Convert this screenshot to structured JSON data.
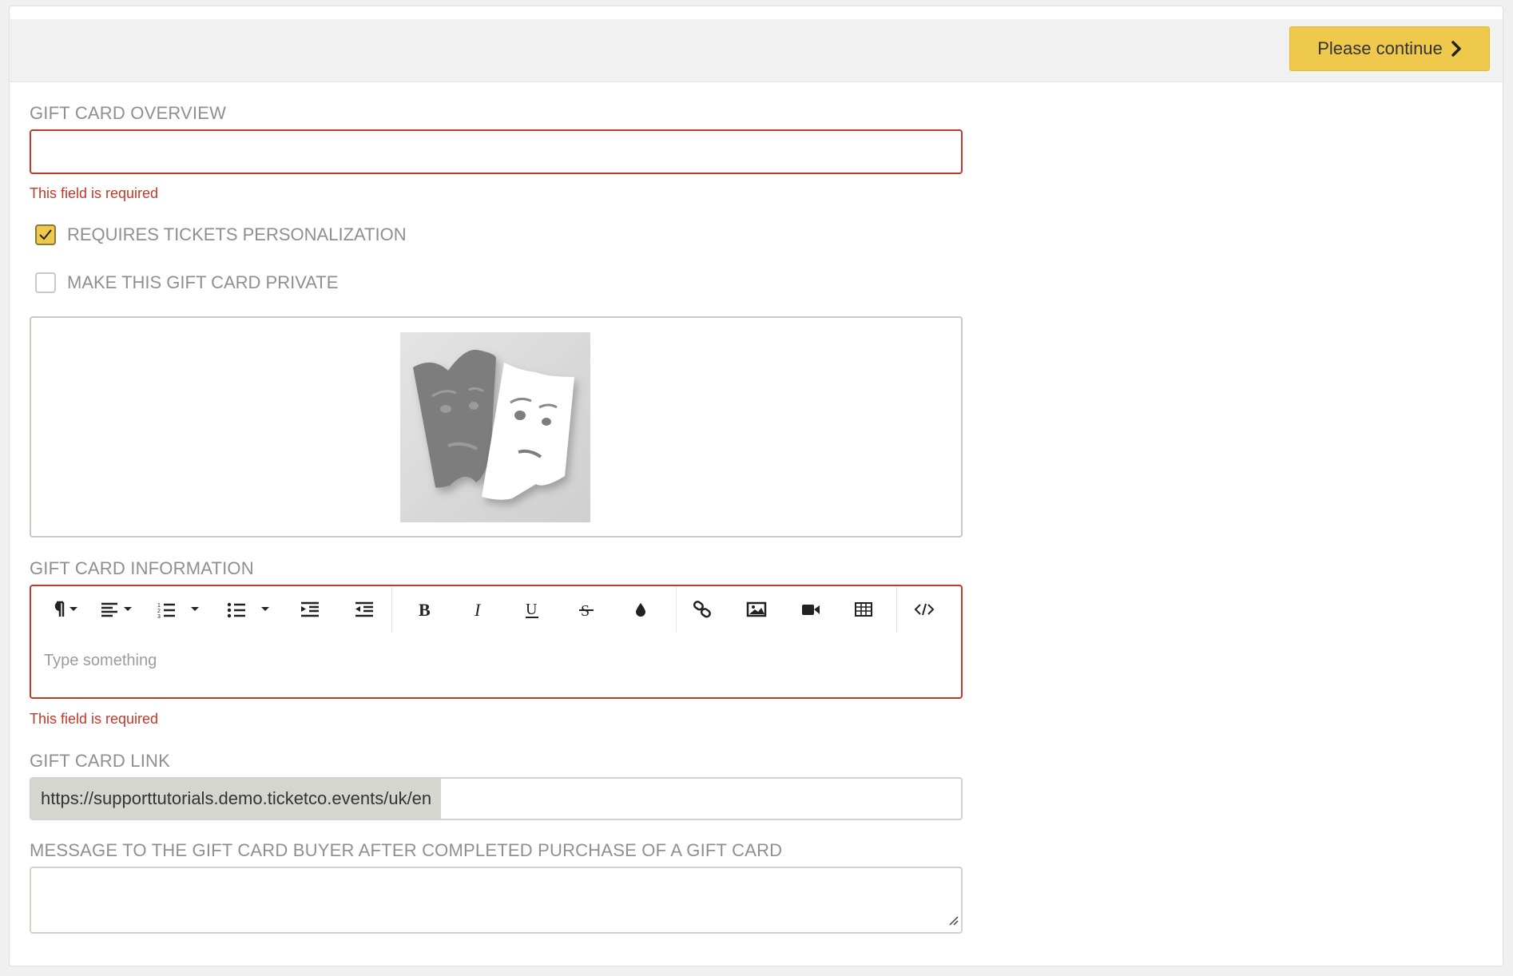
{
  "header": {
    "continue_label": "Please continue",
    "continue_icon": "chevron-right-icon"
  },
  "overview": {
    "label": "GIFT CARD OVERVIEW",
    "value": "",
    "error": "This field is required"
  },
  "options": [
    {
      "label": "REQUIRES TICKETS PERSONALIZATION",
      "checked": true
    },
    {
      "label": "MAKE THIS GIFT CARD PRIVATE",
      "checked": false
    }
  ],
  "image": {
    "icon": "theater-masks-tickets-logo"
  },
  "information": {
    "label": "GIFT CARD INFORMATION",
    "placeholder": "Type something",
    "error": "This field is required",
    "toolbar": [
      "paragraph-format-icon",
      "align-icon",
      "ordered-list-icon",
      "unordered-list-icon",
      "indent-icon",
      "outdent-icon",
      "bold-icon",
      "italic-icon",
      "underline-icon",
      "strikethrough-icon",
      "text-color-icon",
      "link-icon",
      "image-icon",
      "video-icon",
      "table-icon",
      "code-view-icon"
    ]
  },
  "link": {
    "label": "GIFT CARD LINK",
    "prefix": "https://supporttutorials.demo.ticketco.events/uk/en",
    "value": ""
  },
  "message": {
    "label": "MESSAGE TO THE GIFT CARD BUYER AFTER COMPLETED PURCHASE OF A GIFT CARD",
    "value": ""
  },
  "colors": {
    "accent": "#efc94c",
    "error": "#c0392b",
    "label": "#8f8f8f"
  }
}
